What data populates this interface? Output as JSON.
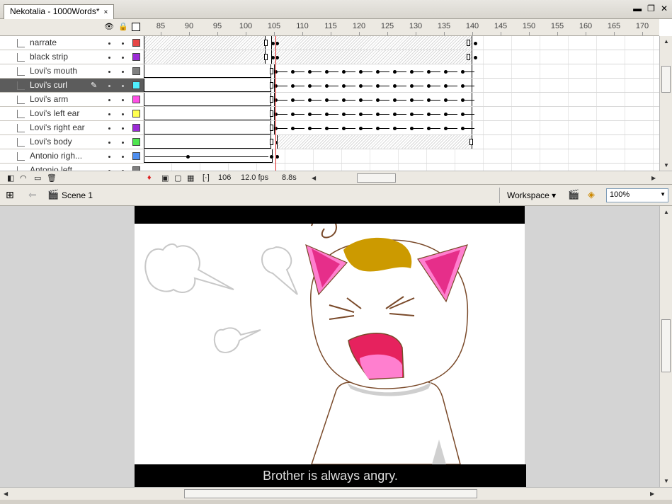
{
  "document": {
    "tab_title": "Nekotalia - 1000Words*"
  },
  "timeline": {
    "frame_numbers": [
      "85",
      "90",
      "95",
      "100",
      "105",
      "110",
      "115",
      "120",
      "125",
      "130",
      "135",
      "140",
      "145",
      "150",
      "155",
      "160",
      "165",
      "170"
    ],
    "layers": [
      {
        "name": "narrate",
        "color": "#e64646",
        "selected": false
      },
      {
        "name": "black strip",
        "color": "#9b2bd6",
        "selected": false
      },
      {
        "name": "Lovi's mouth",
        "color": "#808080",
        "selected": false
      },
      {
        "name": "Lovi's curl",
        "color": "#4ff0ff",
        "selected": true
      },
      {
        "name": "Lovi's arm",
        "color": "#ff4fe6",
        "selected": false
      },
      {
        "name": "Lovi's left ear",
        "color": "#ffff4f",
        "selected": false
      },
      {
        "name": "Lovi's right ear",
        "color": "#9b2bd6",
        "selected": false
      },
      {
        "name": "Lovi's body",
        "color": "#4fe64f",
        "selected": false
      },
      {
        "name": "Antonio righ...",
        "color": "#4f8ff0",
        "selected": false
      },
      {
        "name": "Antonio left",
        "color": "#808080",
        "selected": false
      }
    ],
    "status": {
      "current_frame": "106",
      "frame_rate": "12.0 fps",
      "elapsed": "8.8s"
    }
  },
  "editbar": {
    "scene": "Scene 1",
    "workspace": "Workspace",
    "zoom": "100%"
  },
  "stage": {
    "subtitle": "Brother is always angry."
  }
}
